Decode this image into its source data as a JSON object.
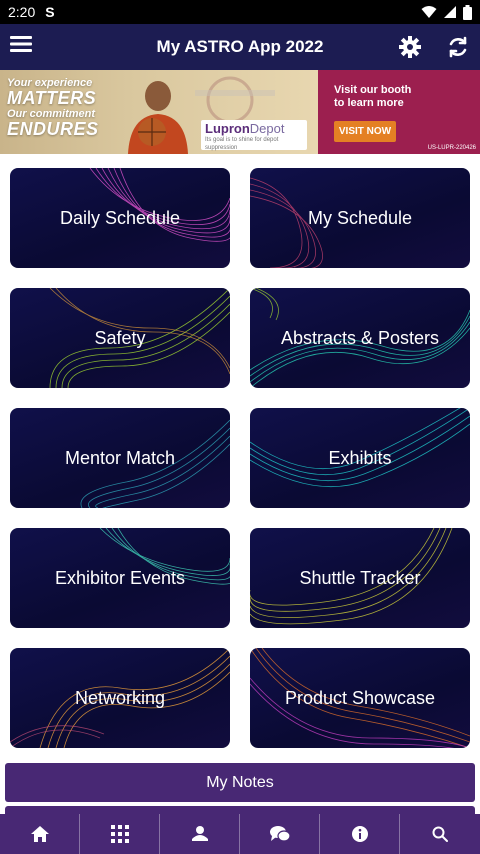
{
  "status_bar": {
    "time": "2:20",
    "app_indicator": "S"
  },
  "header": {
    "title": "My ASTRO App 2022"
  },
  "banner": {
    "tagline_line1": "Your experience",
    "tagline_line2": "MATTERS",
    "tagline_line3": "Our commitment",
    "tagline_line4": "ENDURES",
    "logo_brand": "Lupron",
    "logo_brand_2": "Depot",
    "logo_sub": "Its goal is to shine for depot suppression",
    "visit_text_line1": "Visit our booth",
    "visit_text_line2": "to learn more",
    "visit_button": "VISIT NOW",
    "code": "US-LUPR-220426"
  },
  "tiles": [
    {
      "label": "Daily Schedule"
    },
    {
      "label": "My Schedule"
    },
    {
      "label": "Safety"
    },
    {
      "label": "Abstracts & Posters"
    },
    {
      "label": "Mentor Match"
    },
    {
      "label": "Exhibits"
    },
    {
      "label": "Exhibitor Events"
    },
    {
      "label": "Shuttle Tracker"
    },
    {
      "label": "Networking"
    },
    {
      "label": "Product Showcase"
    }
  ],
  "notes_button": "My Notes",
  "bottom_nav": [
    "home-icon",
    "grid-icon",
    "person-icon",
    "chat-icon",
    "info-icon",
    "search-icon"
  ],
  "colors": {
    "header_bg": "#1c1c52",
    "tile_bg": "#0a0a33",
    "nav_bg": "#482874",
    "banner_cta": "#e48024",
    "banner_right": "#9c1f4f"
  }
}
